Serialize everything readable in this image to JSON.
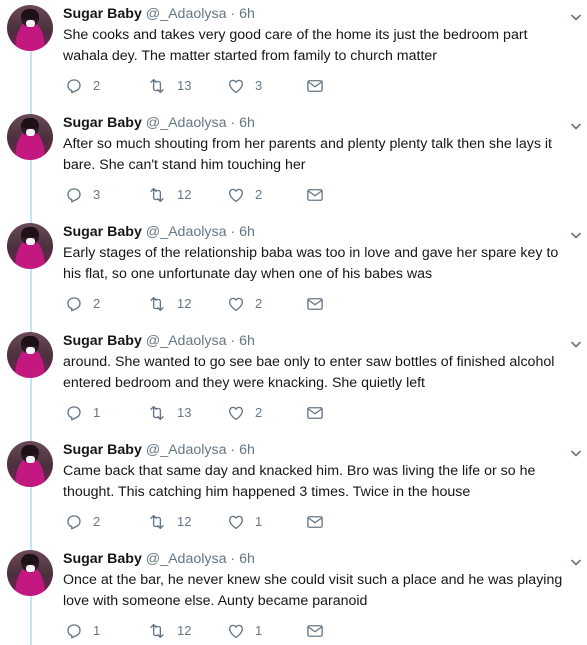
{
  "tweets": [
    {
      "name": "Sugar Baby",
      "handle": "@_Adaolysa",
      "separator": "·",
      "time": "6h",
      "text": "She cooks and takes very good care of the home its just the bedroom part wahala dey. The matter started from family to church matter",
      "replies": "2",
      "retweets": "13",
      "likes": "3"
    },
    {
      "name": "Sugar Baby",
      "handle": "@_Adaolysa",
      "separator": "·",
      "time": "6h",
      "text": "After so much shouting from her parents and plenty plenty talk then she lays it bare. She can't stand him touching her",
      "replies": "3",
      "retweets": "12",
      "likes": "2"
    },
    {
      "name": "Sugar Baby",
      "handle": "@_Adaolysa",
      "separator": "·",
      "time": "6h",
      "text": "Early stages of the relationship baba was too in love and gave her spare key to his flat, so one unfortunate day when one of his babes was",
      "replies": "2",
      "retweets": "12",
      "likes": "2"
    },
    {
      "name": "Sugar Baby",
      "handle": "@_Adaolysa",
      "separator": "·",
      "time": "6h",
      "text": "around. She wanted to go see bae only to enter saw bottles of finished alcohol entered bedroom and they were knacking. She quietly left",
      "replies": "1",
      "retweets": "13",
      "likes": "2"
    },
    {
      "name": "Sugar Baby",
      "handle": "@_Adaolysa",
      "separator": "·",
      "time": "6h",
      "text": "Came back that same day and knacked him. Bro was living the life or so he thought. This catching him happened 3 times. Twice in the house",
      "replies": "2",
      "retweets": "12",
      "likes": "1"
    },
    {
      "name": "Sugar Baby",
      "handle": "@_Adaolysa",
      "separator": "·",
      "time": "6h",
      "text": "Once at the bar, he never knew she could visit such a place and he was playing love with someone else. Aunty became paranoid",
      "replies": "1",
      "retweets": "12",
      "likes": "1"
    }
  ],
  "colors": {
    "thread_line": "#c4e3f7",
    "muted_text": "#657786",
    "primary_text": "#14171a",
    "avatar_accent": "#c2187f"
  },
  "icons": [
    "reply-icon",
    "retweet-icon",
    "like-icon",
    "direct-message-icon",
    "caret-down-icon"
  ]
}
